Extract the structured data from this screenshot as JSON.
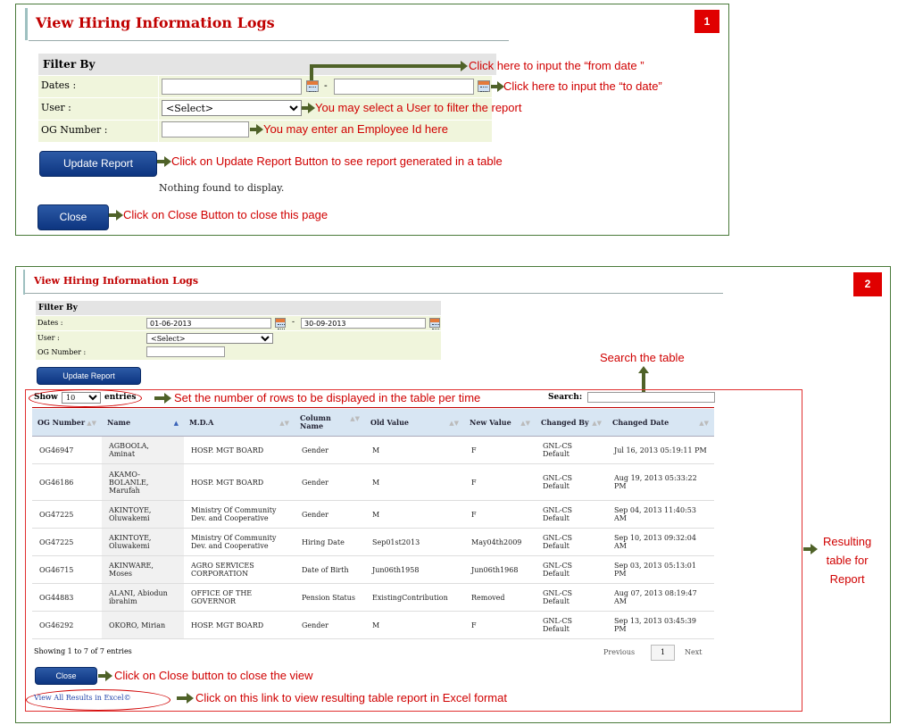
{
  "panel1": {
    "badge": "1",
    "title": "View Hiring Information Logs",
    "filter_header": "Filter By",
    "dates_label": "Dates :",
    "date_sep": "-",
    "user_label": "User :",
    "user_select": "<Select>",
    "og_label": "OG Number :",
    "update_button": "Update Report",
    "empty_text": "Nothing found to display.",
    "close_button": "Close",
    "annotations": {
      "from_date": "Click here to input the “from date ”",
      "to_date": "Click here to input the “to date”",
      "user": "You may select a User to filter the report",
      "og": "You may enter an Employee Id here",
      "update": "Click on Update Report Button to see report generated in a table",
      "close": "Click on Close Button to close this page"
    }
  },
  "panel2": {
    "badge": "2",
    "title": "View Hiring Information Logs",
    "filter_header": "Filter By",
    "dates_label": "Dates :",
    "from_date": "01-06-2013",
    "date_sep": "-",
    "to_date": "30-09-2013",
    "user_label": "User :",
    "user_select": "<Select>",
    "og_label": "OG Number :",
    "update_button": "Update Report",
    "show_label": "Show",
    "entries_select": "10",
    "entries_label": "entries",
    "search_label": "Search:",
    "columns": [
      "OG Number",
      "Name",
      "M.D.A",
      "Column Name",
      "Old Value",
      "New Value",
      "Changed By",
      "Changed Date"
    ],
    "rows": [
      [
        "OG46947",
        "AGBOOLA, Aminat",
        "HOSP. MGT BOARD",
        "Gender",
        "M",
        "F",
        "GNL-CS Default",
        "Jul 16, 2013 05:19:11 PM"
      ],
      [
        "OG46186",
        "AKAMO-BOLANLE, Marufah",
        "HOSP. MGT BOARD",
        "Gender",
        "M",
        "F",
        "GNL-CS Default",
        "Aug 19, 2013 05:33:22 PM"
      ],
      [
        "OG47225",
        "AKINTOYE, Oluwakemi",
        "Ministry Of Community Dev. and Cooperative",
        "Gender",
        "M",
        "F",
        "GNL-CS Default",
        "Sep 04, 2013 11:40:53 AM"
      ],
      [
        "OG47225",
        "AKINTOYE, Oluwakemi",
        "Ministry Of Community Dev. and Cooperative",
        "Hiring Date",
        "Sep01st2013",
        "May04th2009",
        "GNL-CS Default",
        "Sep 10, 2013 09:32:04 AM"
      ],
      [
        "OG46715",
        "AKINWARE, Moses",
        "AGRO SERVICES CORPORATION",
        "Date of Birth",
        "Jun06th1958",
        "Jun06th1968",
        "GNL-CS Default",
        "Sep 03, 2013 05:13:01 PM"
      ],
      [
        "OG44883",
        "ALANI, Abiodun ibrahim",
        "OFFICE OF THE GOVERNOR",
        "Pension Status",
        "ExistingContribution",
        "Removed",
        "GNL-CS Default",
        "Aug 07, 2013 08:19:47 AM"
      ],
      [
        "OG46292",
        "OKORO, Mirian",
        "HOSP. MGT BOARD",
        "Gender",
        "M",
        "F",
        "GNL-CS Default",
        "Sep 13, 2013 03:45:39 PM"
      ]
    ],
    "showing_text": "Showing 1 to 7 of 7 entries",
    "prev_label": "Previous",
    "page_number": "1",
    "next_label": "Next",
    "close_button": "Close",
    "excel_link": "View All Results in Excel©",
    "annotations": {
      "search": "Search the table",
      "rows": "Set the number of rows to be displayed in the table per time",
      "result_line1": "Resulting",
      "result_line2": "table for",
      "result_line3": "Report",
      "close": "Click on Close button to close the view",
      "excel": "Click on this link to view resulting table report in Excel format"
    }
  },
  "colors": {
    "annotation": "#d00000",
    "arrow": "#4f6228",
    "button": "#0d3580",
    "badge": "#e00000",
    "title": "#c00000"
  }
}
